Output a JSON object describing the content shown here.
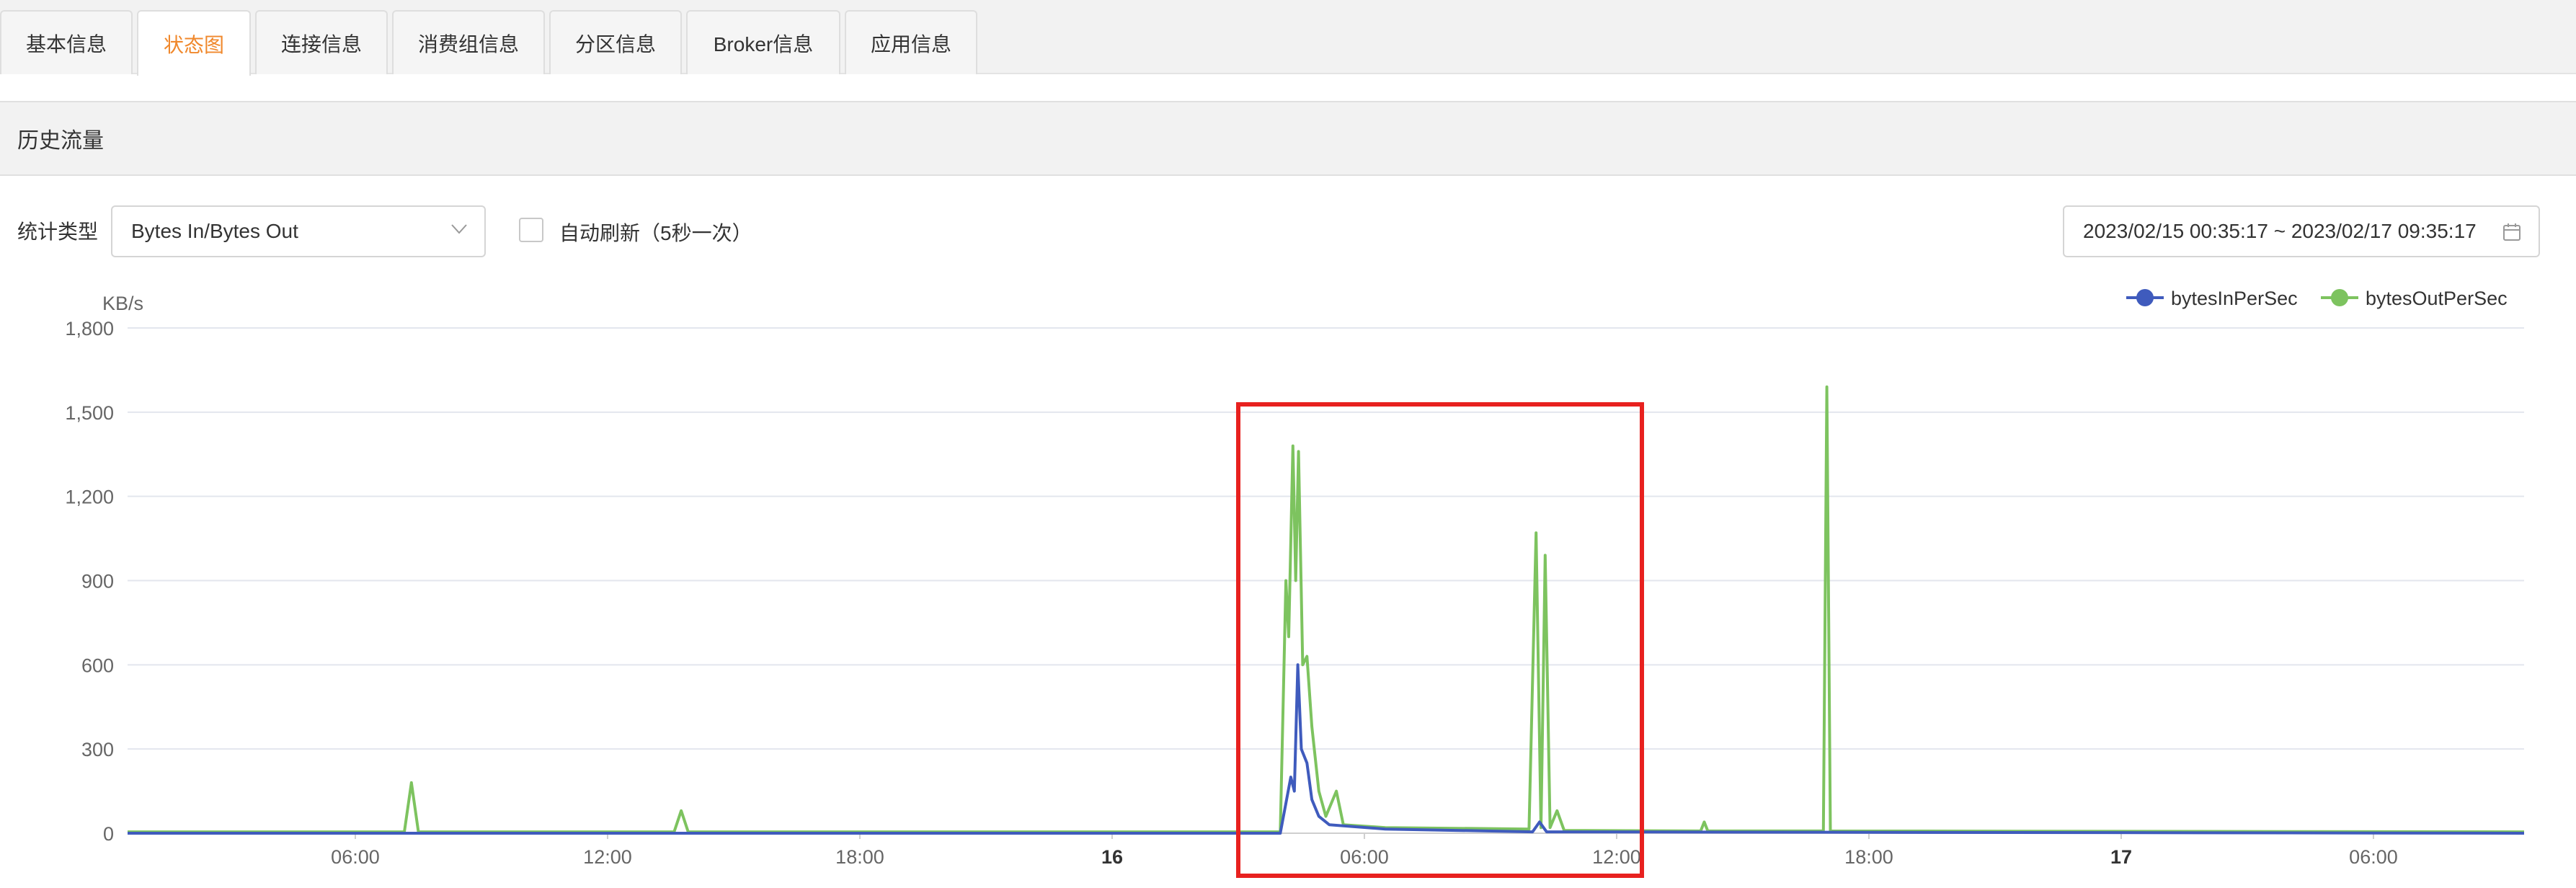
{
  "tabs": [
    {
      "label": "基本信息",
      "active": false
    },
    {
      "label": "状态图",
      "active": true
    },
    {
      "label": "连接信息",
      "active": false
    },
    {
      "label": "消费组信息",
      "active": false
    },
    {
      "label": "分区信息",
      "active": false
    },
    {
      "label": "Broker信息",
      "active": false
    },
    {
      "label": "应用信息",
      "active": false
    }
  ],
  "section": {
    "title": "历史流量"
  },
  "toolbar": {
    "stat_type_label": "统计类型",
    "stat_type_value": "Bytes In/Bytes Out",
    "auto_refresh_label": "自动刷新（5秒一次）",
    "auto_refresh_checked": false,
    "date_range": "2023/02/15 00:35:17 ~ 2023/02/17 09:35:17"
  },
  "chart_data": {
    "type": "line",
    "ylabel": "KB/s",
    "ylim": [
      0,
      1800
    ],
    "yticks": [
      "0",
      "300",
      "600",
      "900",
      "1,200",
      "1,500",
      "1,800"
    ],
    "xticks": [
      "06:00",
      "12:00",
      "18:00",
      "16",
      "06:00",
      "12:00",
      "18:00",
      "17",
      "06:00"
    ],
    "xlim": [
      "2023-02-15T00:35",
      "2023-02-17T09:35"
    ],
    "legend_position": "top-right",
    "grid": true,
    "series": [
      {
        "name": "bytesInPerSec",
        "color": "#3f5bbd",
        "points": [
          [
            "2023-02-15T00:35",
            0
          ],
          [
            "2023-02-16T04:00",
            0
          ],
          [
            "2023-02-16T04:15",
            200
          ],
          [
            "2023-02-16T04:20",
            150
          ],
          [
            "2023-02-16T04:25",
            600
          ],
          [
            "2023-02-16T04:30",
            300
          ],
          [
            "2023-02-16T04:38",
            250
          ],
          [
            "2023-02-16T04:45",
            120
          ],
          [
            "2023-02-16T04:55",
            60
          ],
          [
            "2023-02-16T05:10",
            30
          ],
          [
            "2023-02-16T06:30",
            15
          ],
          [
            "2023-02-16T10:00",
            5
          ],
          [
            "2023-02-16T10:10",
            40
          ],
          [
            "2023-02-16T10:20",
            5
          ],
          [
            "2023-02-17T09:35",
            0
          ]
        ]
      },
      {
        "name": "bytesOutPerSec",
        "color": "#7dc35f",
        "points": [
          [
            "2023-02-15T00:35",
            5
          ],
          [
            "2023-02-15T07:10",
            5
          ],
          [
            "2023-02-15T07:20",
            180
          ],
          [
            "2023-02-15T07:30",
            5
          ],
          [
            "2023-02-15T13:35",
            5
          ],
          [
            "2023-02-15T13:45",
            80
          ],
          [
            "2023-02-15T13:55",
            5
          ],
          [
            "2023-02-16T04:00",
            5
          ],
          [
            "2023-02-16T04:08",
            900
          ],
          [
            "2023-02-16T04:12",
            700
          ],
          [
            "2023-02-16T04:18",
            1380
          ],
          [
            "2023-02-16T04:22",
            900
          ],
          [
            "2023-02-16T04:26",
            1360
          ],
          [
            "2023-02-16T04:32",
            600
          ],
          [
            "2023-02-16T04:38",
            630
          ],
          [
            "2023-02-16T04:45",
            380
          ],
          [
            "2023-02-16T04:55",
            150
          ],
          [
            "2023-02-16T05:05",
            60
          ],
          [
            "2023-02-16T05:20",
            150
          ],
          [
            "2023-02-16T05:30",
            30
          ],
          [
            "2023-02-16T06:30",
            20
          ],
          [
            "2023-02-16T09:55",
            15
          ],
          [
            "2023-02-16T10:05",
            1070
          ],
          [
            "2023-02-16T10:12",
            20
          ],
          [
            "2023-02-16T10:18",
            990
          ],
          [
            "2023-02-16T10:25",
            20
          ],
          [
            "2023-02-16T10:35",
            80
          ],
          [
            "2023-02-16T10:45",
            10
          ],
          [
            "2023-02-16T14:00",
            8
          ],
          [
            "2023-02-16T14:05",
            40
          ],
          [
            "2023-02-16T14:10",
            8
          ],
          [
            "2023-02-16T16:55",
            8
          ],
          [
            "2023-02-16T17:00",
            1590
          ],
          [
            "2023-02-16T17:05",
            8
          ],
          [
            "2023-02-17T09:35",
            5
          ]
        ]
      }
    ]
  }
}
